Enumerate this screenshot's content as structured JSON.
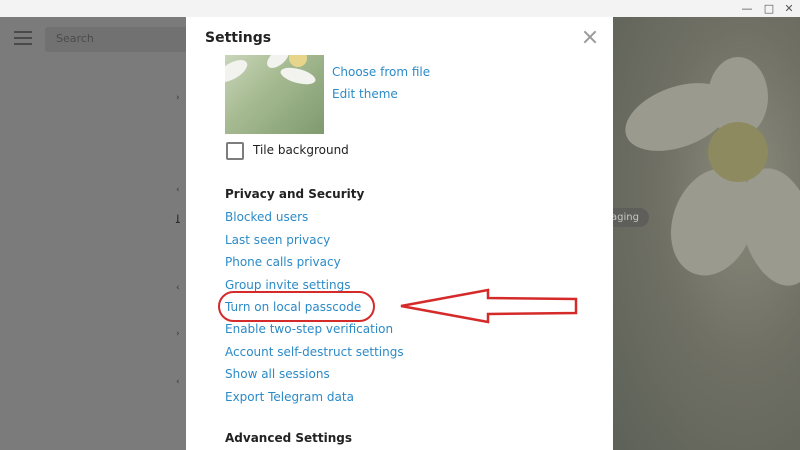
{
  "window": {
    "minimize_icon": "minimize-icon",
    "maximize_icon": "maximize-icon",
    "close_icon": "close-icon"
  },
  "left_panel": {
    "search_placeholder": "Search",
    "chat_stubs": [
      "›",
      "‹",
      "ﻠ",
      "‹",
      "›",
      "‹"
    ]
  },
  "wallpaper": {
    "badge_text": "aging"
  },
  "dialog": {
    "title": "Settings",
    "background": {
      "choose_from_file": "Choose from file",
      "edit_theme": "Edit theme",
      "tile_background": "Tile background",
      "tile_checked": false
    },
    "privacy": {
      "heading": "Privacy and Security",
      "items": [
        "Blocked users",
        "Last seen privacy",
        "Phone calls privacy",
        "Group invite settings",
        "Turn on local passcode",
        "Enable two-step verification",
        "Account self-destruct settings",
        "Show all sessions",
        "Export Telegram data"
      ]
    },
    "advanced_heading": "Advanced Settings"
  },
  "colors": {
    "link": "#2b8ac7",
    "annotation": "#d52a2a",
    "overlay": "#6e6e63"
  },
  "annotation": {
    "highlight_target": "Turn on local passcode",
    "arrow_icon": "left-arrow-icon"
  }
}
